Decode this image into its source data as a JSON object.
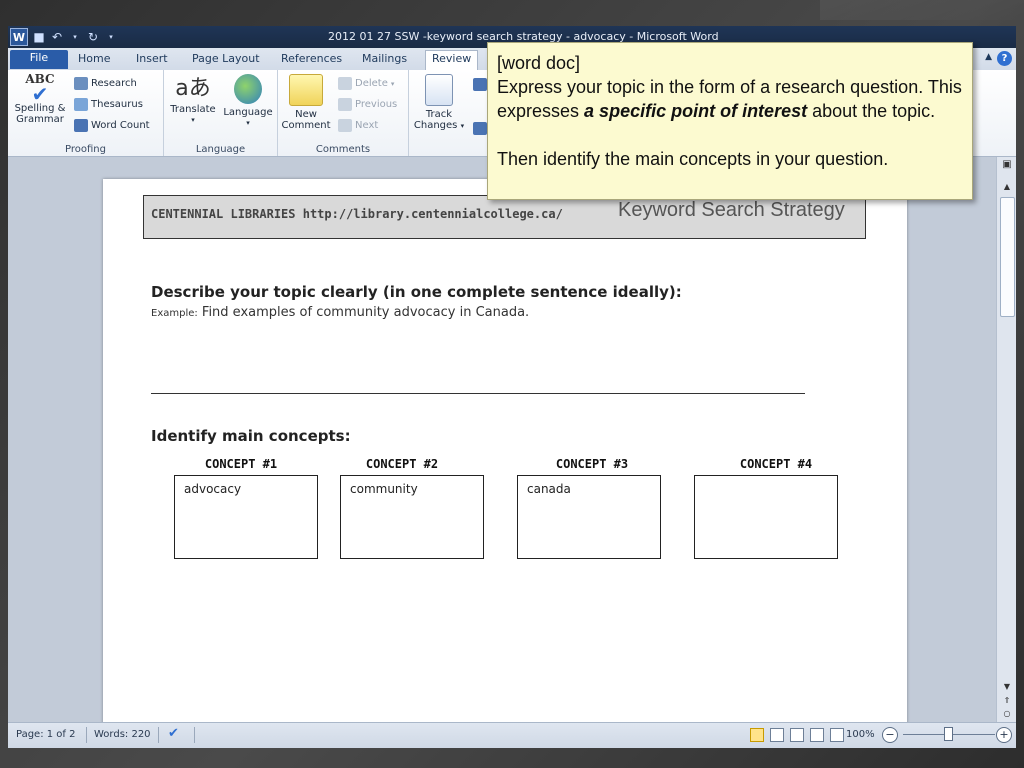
{
  "window": {
    "title": "2012 01 27 SSW -keyword search strategy - advocacy  -  Microsoft Word",
    "logo_letter": "W"
  },
  "tabs": {
    "file": "File",
    "items": [
      "Home",
      "Insert",
      "Page Layout",
      "References",
      "Mailings",
      "Review"
    ]
  },
  "ribbon": {
    "proofing": {
      "label": "Proofing",
      "spelling_line1": "Spelling &",
      "spelling_line2": "Grammar",
      "spelling_icon_text": "ABC",
      "research": "Research",
      "thesaurus": "Thesaurus",
      "word_count": "Word Count"
    },
    "language": {
      "label": "Language",
      "translate": "Translate",
      "language": "Language"
    },
    "comments": {
      "label": "Comments",
      "new_line1": "New",
      "new_line2": "Comment",
      "delete": "Delete",
      "previous": "Previous",
      "next": "Next"
    },
    "tracking": {
      "track_line1": "Track",
      "track_line2": "Changes"
    }
  },
  "document": {
    "header_org": "CENTENNIAL  LIBRARIES http://library.centennialcollege.ca/",
    "header_title": "Keyword Search Strategy",
    "describe_heading": "Describe your topic clearly (in one complete sentence ideally):",
    "example_label": "Example:",
    "example_text": "Find examples of community advocacy in Canada.",
    "identify_heading": "Identify main concepts:",
    "concepts": [
      {
        "label": "CONCEPT #1",
        "value": "advocacy"
      },
      {
        "label": "CONCEPT #2",
        "value": "community"
      },
      {
        "label": "CONCEPT #3",
        "value": "canada"
      },
      {
        "label": "CONCEPT #4",
        "value": ""
      }
    ]
  },
  "status": {
    "page": "Page: 1 of 2",
    "words": "Words: 220",
    "zoom": "100%"
  },
  "callout": {
    "line1": "[word doc]",
    "line2_prefix": "Express your topic in the form of a research question. This expresses ",
    "line2_emphasis": "a specific point of interest",
    "line2_suffix": " about the topic.",
    "line3": "Then identify the main concepts in your question."
  },
  "icons": {
    "save": "save-icon",
    "undo": "undo-icon",
    "redo": "redo-icon",
    "help": "help-icon",
    "proofing_check": "proofing-check-icon"
  },
  "colors": {
    "title_bar": "#1f3556",
    "file_tab": "#2a5ca8",
    "callout_bg": "#fcfad0",
    "doc_bg": "#c2cbd8"
  }
}
